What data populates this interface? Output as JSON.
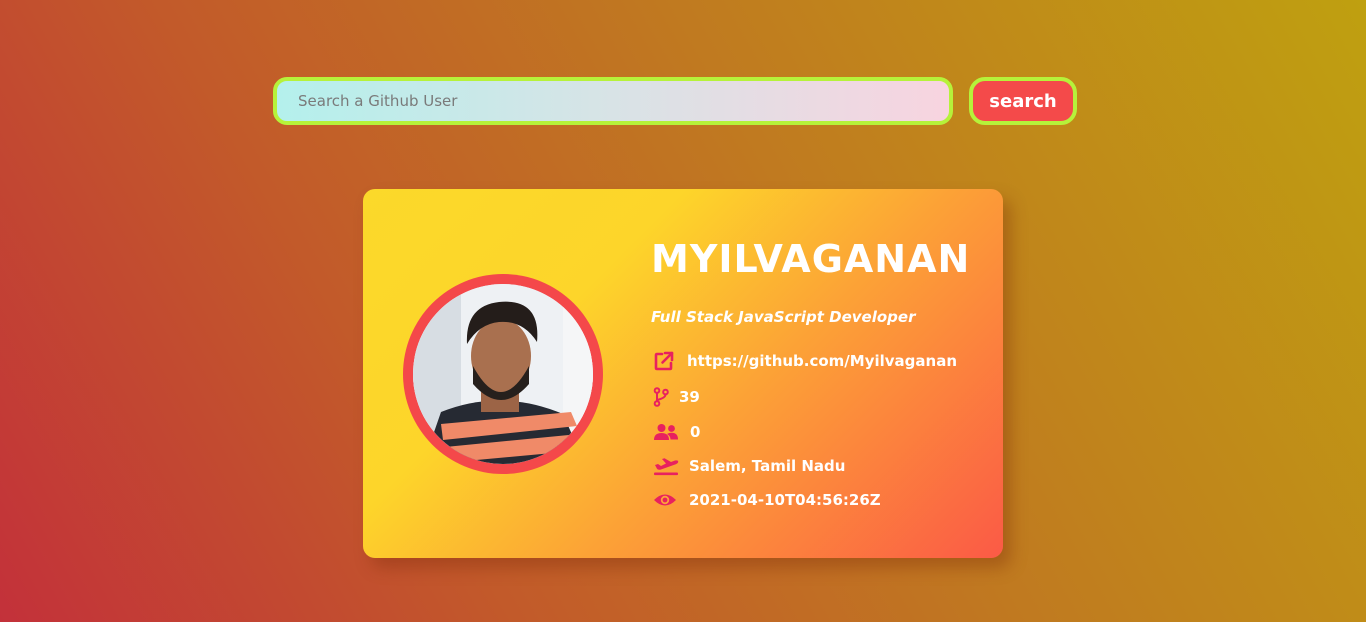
{
  "search": {
    "placeholder": "Search a Github User",
    "value": "",
    "button_label": "search"
  },
  "profile": {
    "name": "MYILVAGANAN",
    "bio": "Full Stack JavaScript Developer",
    "url": "https://github.com/Myilvaganan",
    "repos": "39",
    "followers": "0",
    "location": "Salem, Tamil Nadu",
    "updated_at": "2021-04-10T04:56:26Z"
  },
  "icons": {
    "link": "external-link-icon",
    "repos": "code-branch-icon",
    "followers": "users-icon",
    "location": "plane-departure-icon",
    "updated": "eye-icon"
  },
  "colors": {
    "accent_border": "#b6f23a",
    "button_bg": "#f44a4a",
    "icon_color": "#e8215f",
    "avatar_ring": "#f4484a",
    "text": "#ffffff"
  }
}
